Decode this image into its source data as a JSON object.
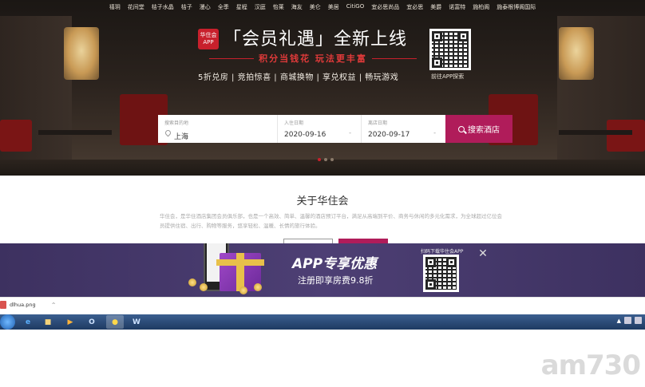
{
  "topnav": {
    "items": [
      "禧玥",
      "花间堂",
      "桔子水晶",
      "桔子",
      "漫心",
      "全季",
      "星程",
      "汉庭",
      "怡莱",
      "海友",
      "美仑",
      "美居",
      "CitiGO",
      "宜必思尚品",
      "宜必思",
      "美爵",
      "诺富特",
      "施柏阁",
      "施泰根博阁国际"
    ]
  },
  "promo": {
    "logo_text": "华住会 APP",
    "title": "「会员礼遇」全新上线",
    "subtitle": "积分当钱花 玩法更丰富",
    "features": "5折兑房 | 竞拍惊喜 | 商城换物 | 享兑权益 | 畅玩游戏",
    "qr_label": "前往APP探索"
  },
  "search": {
    "destination_label": "搜索目的地",
    "destination_value": "上海",
    "checkin_label": "入住日期",
    "checkin_value": "2020-09-16",
    "checkout_label": "离店日期",
    "checkout_value": "2020-09-17",
    "dash": "-",
    "button_label": "搜索酒店"
  },
  "about": {
    "title": "关于华住会",
    "text": "华住会，是华住酒店集团会员俱乐部，也是一个高效、简单、温馨的酒店预订平台，满足从高端到平价、商务与休闲的多元化需求，为全球超过亿位会员提供住宿、出行、购物等服务，悠享轻松、温暖、长情的旅行体验。"
  },
  "app_banner": {
    "title": "APP专享优惠",
    "subtitle": "注册即享房费9.8折",
    "download_label": "扫码下载华住会APP",
    "close": "✕"
  },
  "download_shelf": {
    "filename": "dlhua.png",
    "caret": "^"
  },
  "taskbar": {
    "tray_arrow": "▲"
  },
  "watermark": "am730"
}
